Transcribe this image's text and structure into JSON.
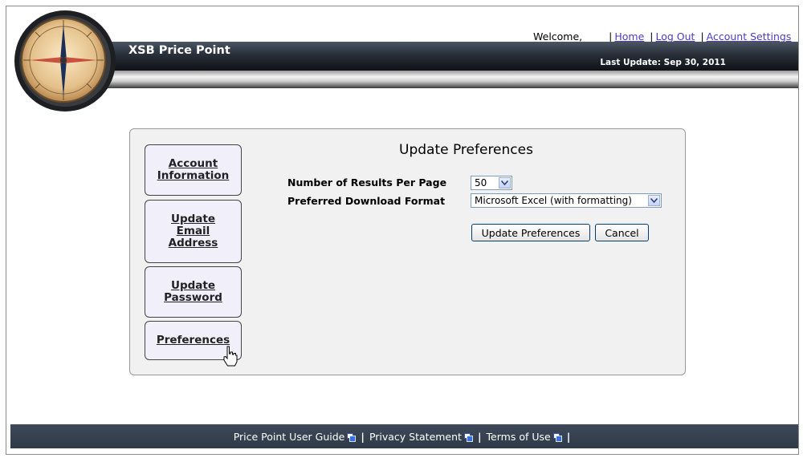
{
  "header": {
    "welcome": "Welcome,",
    "links": [
      "Home",
      "Log Out",
      "Account Settings"
    ],
    "app_title": "XSB Price Point",
    "last_update": "Last Update: Sep 30, 2011"
  },
  "sidebar": {
    "items": [
      {
        "label": "Account\nInformation"
      },
      {
        "label": "Update\nEmail\nAddress"
      },
      {
        "label": "Update\nPassword"
      },
      {
        "label": "Preferences"
      }
    ]
  },
  "main": {
    "title": "Update Preferences",
    "fields": [
      {
        "label": "Number of Results Per Page",
        "value": "50"
      },
      {
        "label": "Preferred Download Format",
        "value": "Microsoft Excel (with formatting)"
      }
    ],
    "update_button": "Update Preferences",
    "cancel_button": "Cancel"
  },
  "footer": {
    "links": [
      "Price Point User Guide",
      "Privacy Statement",
      "Terms of Use"
    ]
  },
  "icons": {
    "logo": "compass-logo-icon",
    "external": "external-window-icon",
    "cursor": "hand-pointer-icon",
    "dropdown": "chevron-down-icon"
  }
}
